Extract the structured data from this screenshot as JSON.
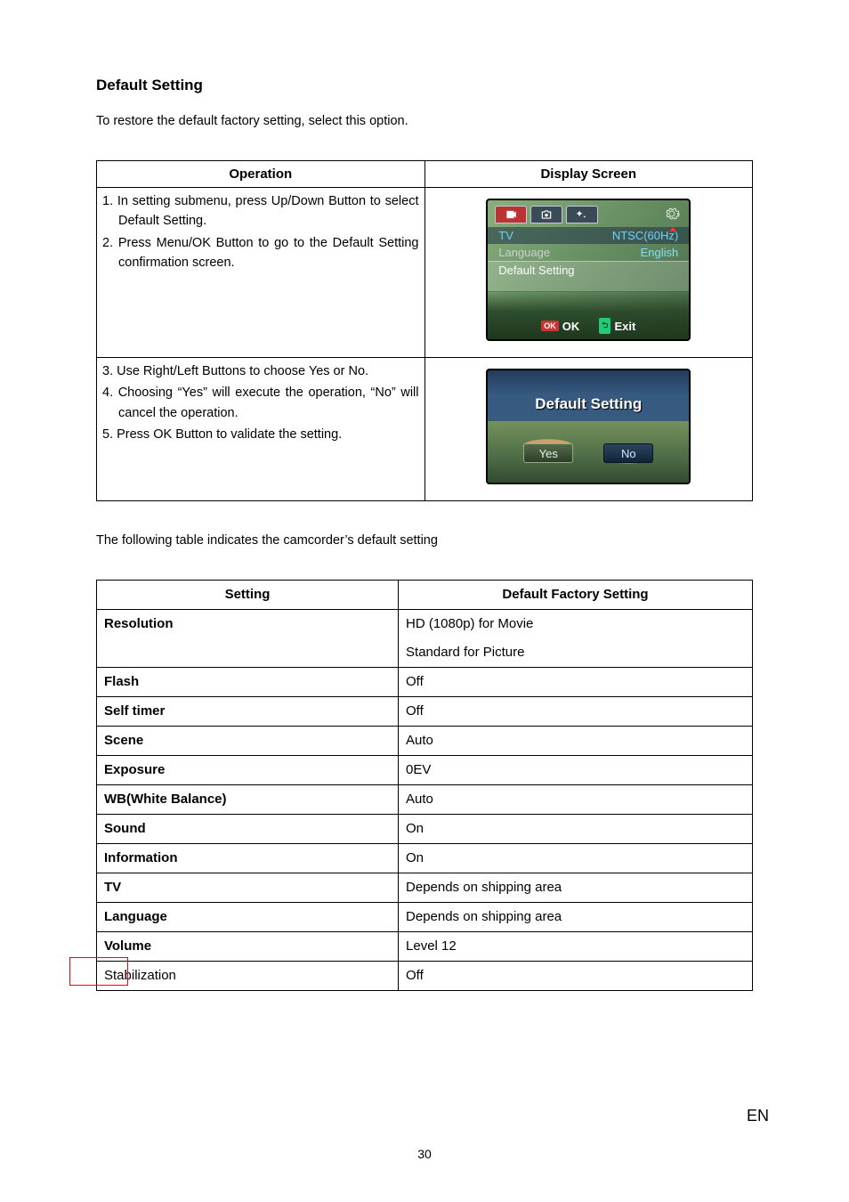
{
  "section_title": "Default Setting",
  "intro_text": "To restore the default factory setting, select this option.",
  "op_table": {
    "header_operation": "Operation",
    "header_display": "Display Screen",
    "row1_step1": "1. In setting submenu, press Up/Down Button to select Default Setting.",
    "row1_step2": "2.  Press Menu/OK Button to go to the Default Setting confirmation screen.",
    "row2_step3": "3. Use Right/Left Buttons to choose Yes or No.",
    "row2_step4": "4. Choosing “Yes” will execute the operation, “No” will cancel the operation.",
    "row2_step5": "5. Press OK Button to validate the setting."
  },
  "screen1": {
    "row_tv_label": "TV",
    "row_tv_value": "NTSC(60Hz)",
    "row_lang_label": "Language",
    "row_lang_value": "English",
    "row_default": "Default Setting",
    "footer_ok_badge": "OK",
    "footer_ok": "OK",
    "footer_exit": "Exit"
  },
  "screen2": {
    "title": "Default Setting",
    "yes": "Yes",
    "no": "No"
  },
  "table_intro": "The following table indicates the camcorder’s default setting",
  "def_table": {
    "header_setting": "Setting",
    "header_default": "Default Factory Setting",
    "rows": [
      {
        "name": "Resolution",
        "value": "HD (1080p) for Movie",
        "bold": true,
        "value2": "Standard for Picture"
      },
      {
        "name": "Flash",
        "value": "Off",
        "bold": true
      },
      {
        "name": "Self timer",
        "value": "Off",
        "bold": true
      },
      {
        "name": "Scene",
        "value": "Auto",
        "bold": true
      },
      {
        "name": "Exposure",
        "value": "0EV",
        "bold": true
      },
      {
        "name": "WB(White Balance)",
        "value": "Auto",
        "bold": true
      },
      {
        "name": "Sound",
        "value": "On",
        "bold": true
      },
      {
        "name": "Information",
        "value": "On",
        "bold": true
      },
      {
        "name": "TV",
        "value": "Depends on shipping area",
        "bold": true
      },
      {
        "name": "Language",
        "value": "Depends on shipping area",
        "bold": true
      },
      {
        "name": "Volume",
        "value": "Level 12",
        "bold": true
      },
      {
        "name": "Stabilization",
        "value": "Off",
        "bold": false
      }
    ]
  },
  "page_number": "30",
  "lang_code": "EN"
}
